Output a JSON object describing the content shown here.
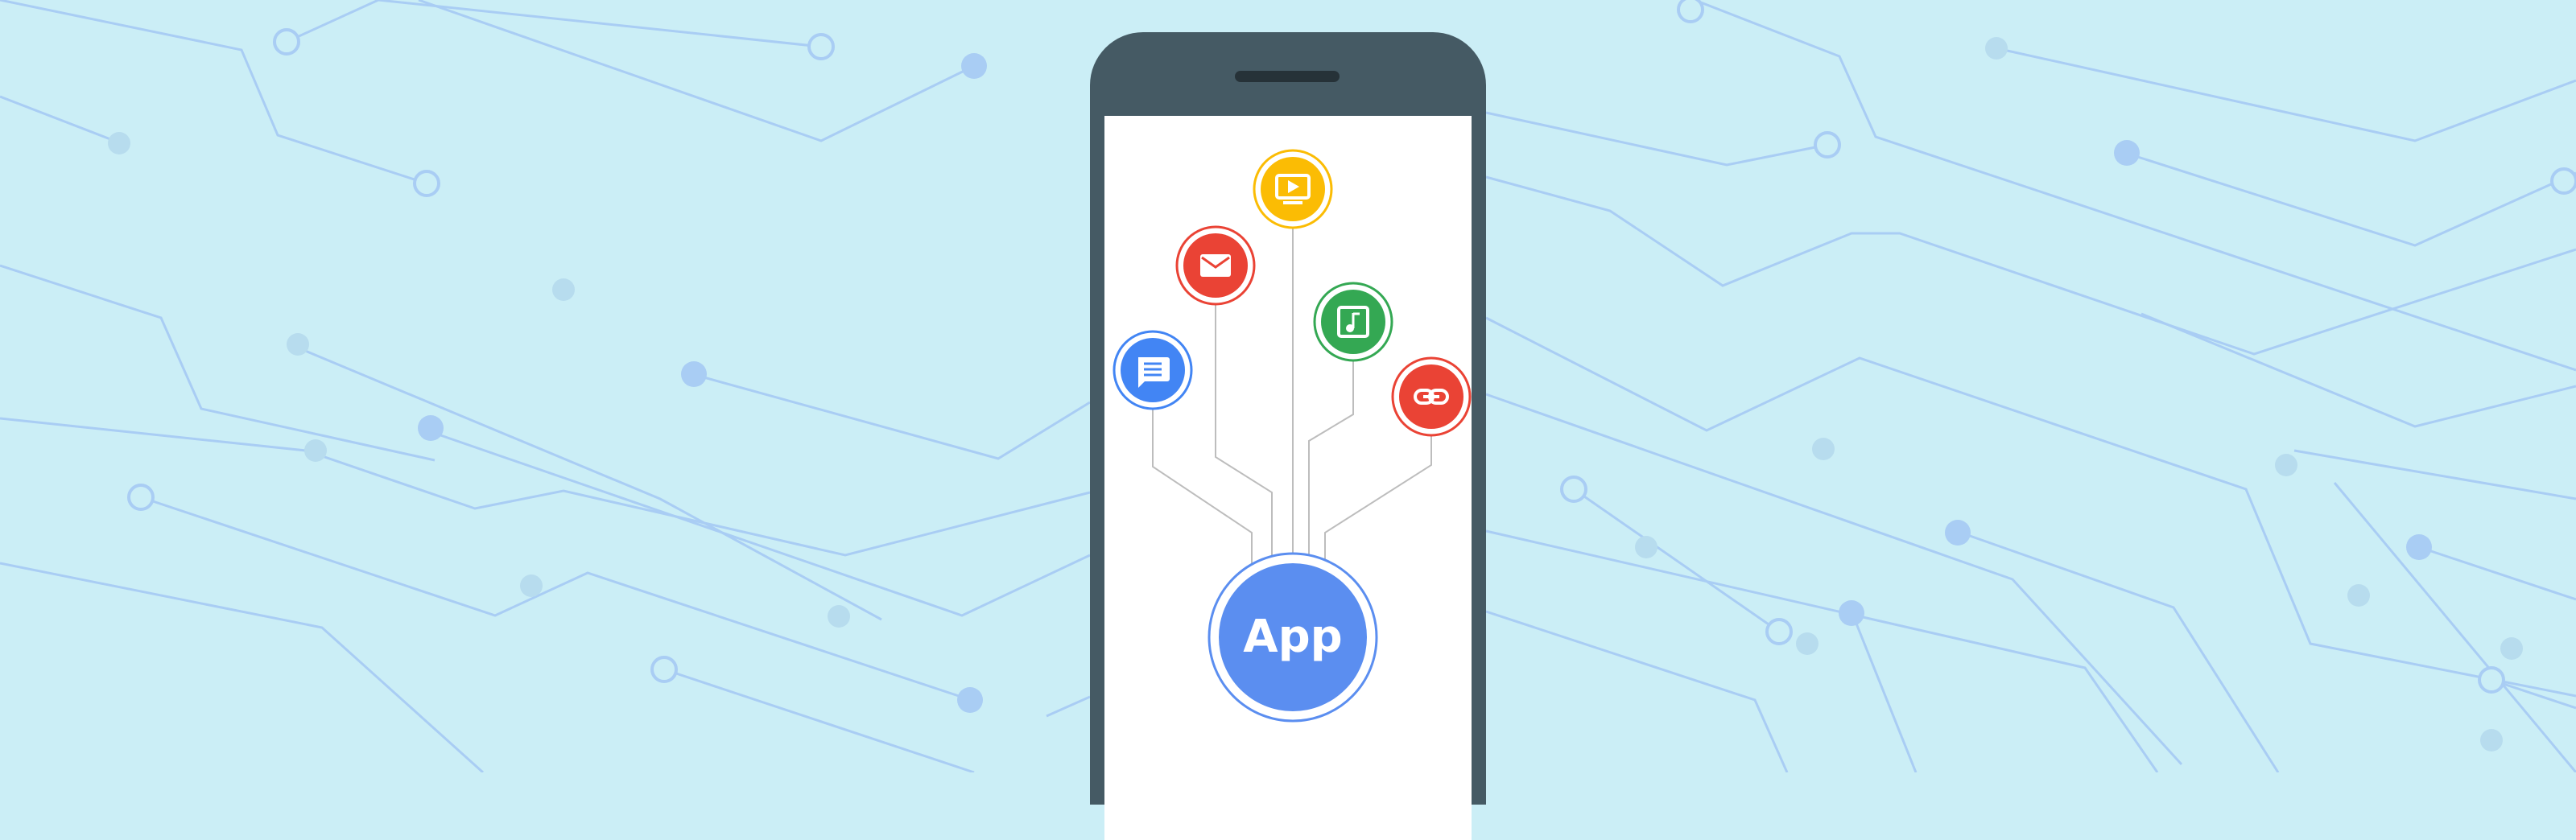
{
  "app_label": "App",
  "colors": {
    "background": "#cbeef6",
    "circuit_line": "#a9cdf4",
    "phone_body": "#455a64",
    "screen": "#ffffff",
    "app_blue": "#5b8ef0",
    "blue": "#4285f4",
    "red": "#ea4335",
    "yellow": "#fbbc04",
    "green": "#34a853"
  },
  "icons": [
    {
      "name": "message-icon",
      "color": "#4285f4"
    },
    {
      "name": "mail-icon",
      "color": "#ea4335"
    },
    {
      "name": "video-player-icon",
      "color": "#fbbc04"
    },
    {
      "name": "music-icon",
      "color": "#34a853"
    },
    {
      "name": "link-icon",
      "color": "#ea4335"
    }
  ]
}
